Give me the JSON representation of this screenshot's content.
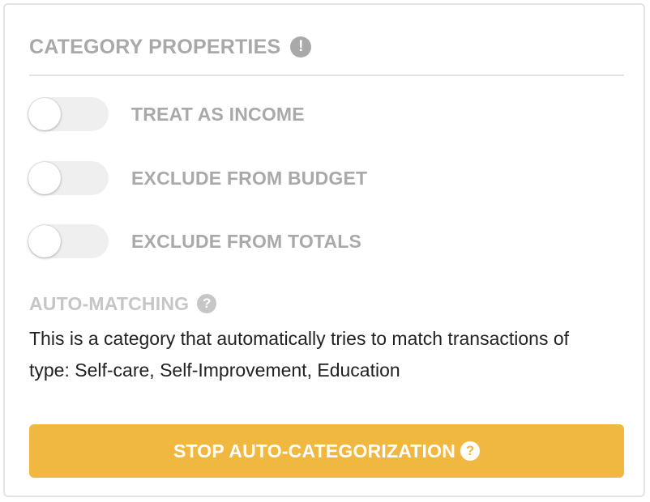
{
  "header": {
    "title": "CATEGORY PROPERTIES",
    "info_icon": "exclamation-circle-icon",
    "info_glyph": "!"
  },
  "toggles": [
    {
      "label": "TREAT AS INCOME",
      "checked": false
    },
    {
      "label": "EXCLUDE FROM BUDGET",
      "checked": false
    },
    {
      "label": "EXCLUDE FROM TOTALS",
      "checked": false
    }
  ],
  "auto_matching": {
    "title": "AUTO-MATCHING",
    "help_icon": "question-circle-icon",
    "help_glyph": "?",
    "description": "This is a category that automatically tries to match transactions of type: Self-care, Self-Improvement, Education"
  },
  "stop_button": {
    "label": "STOP AUTO-CATEGORIZATION",
    "help_icon": "question-circle-icon",
    "help_glyph": "?"
  },
  "colors": {
    "muted_text": "#a9a9a9",
    "light_muted_text": "#c6c6c6",
    "accent": "#f0b840",
    "toggle_track": "#efefef",
    "border": "#e4e4e4"
  }
}
